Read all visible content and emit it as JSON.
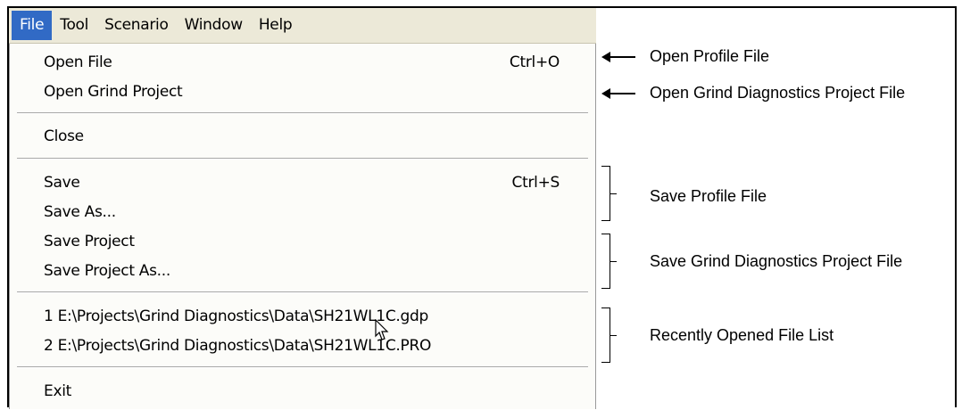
{
  "menubar": {
    "items": [
      {
        "label": "File",
        "active": true
      },
      {
        "label": "Tool"
      },
      {
        "label": "Scenario"
      },
      {
        "label": "Window"
      },
      {
        "label": "Help"
      }
    ]
  },
  "file_menu": {
    "open_file": {
      "label": "Open File",
      "shortcut": "Ctrl+O"
    },
    "open_grind_project": {
      "label": "Open Grind Project"
    },
    "close": {
      "label": "Close"
    },
    "save": {
      "label": "Save",
      "shortcut": "Ctrl+S"
    },
    "save_as": {
      "label": "Save As..."
    },
    "save_project": {
      "label": "Save Project"
    },
    "save_project_as": {
      "label": "Save Project As..."
    },
    "recent_1": {
      "label": "1 E:\\Projects\\Grind Diagnostics\\Data\\SH21WL1C.gdp"
    },
    "recent_2": {
      "label": "2 E:\\Projects\\Grind Diagnostics\\Data\\SH21WL1C.PRO"
    },
    "exit": {
      "label": "Exit"
    }
  },
  "annotations": {
    "open_profile": "Open Profile File",
    "open_grind_project": "Open Grind Diagnostics Project File",
    "save_profile": "Save Profile File",
    "save_grind_project": "Save Grind Diagnostics Project File",
    "recent_list": "Recently Opened File List"
  },
  "colors": {
    "menubar_bg": "#ece9d8",
    "highlight": "#316ac5",
    "menu_bg": "#fcfcf9"
  }
}
